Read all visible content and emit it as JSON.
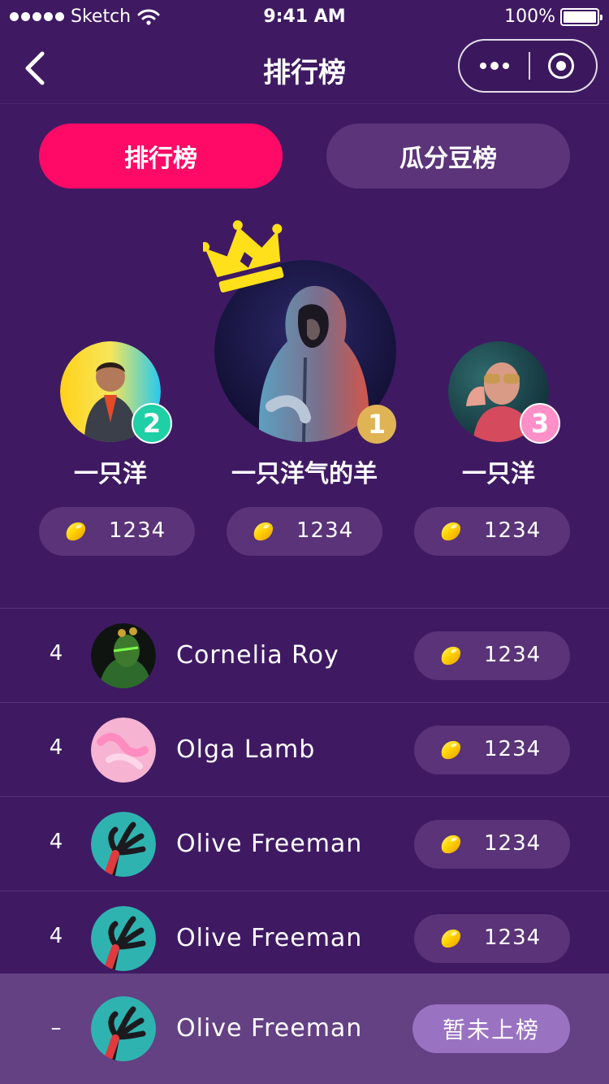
{
  "status_bar": {
    "carrier": "Sketch",
    "time": "9:41 AM",
    "battery": "100%",
    "battery_level": 1.0
  },
  "nav": {
    "title": "排行榜",
    "back_icon": "chevron-left-icon",
    "more_icon": "more-dots-icon",
    "close_icon": "record-circle-icon"
  },
  "tabs": [
    {
      "label": "排行榜",
      "active": true
    },
    {
      "label": "瓜分豆榜",
      "active": false
    }
  ],
  "podium": [
    {
      "rank": "1",
      "name": "一只洋气的羊",
      "score": "1234"
    },
    {
      "rank": "2",
      "name": "一只洋",
      "score": "1234"
    },
    {
      "rank": "3",
      "name": "一只洋",
      "score": "1234"
    }
  ],
  "list": [
    {
      "rank": "4",
      "name": "Cornelia Roy",
      "score": "1234"
    },
    {
      "rank": "4",
      "name": "Olga Lamb",
      "score": "1234"
    },
    {
      "rank": "4",
      "name": "Olive Freeman",
      "score": "1234"
    },
    {
      "rank": "4",
      "name": "Olive Freeman",
      "score": "1234"
    }
  ],
  "self": {
    "rank": "–",
    "name": "Olive Freeman",
    "status": "暂未上榜"
  },
  "colors": {
    "background": "#3f1a63",
    "tab_active": "#ff0a66",
    "tab_inactive": "#5b3479",
    "pill": "#5a3378",
    "self_row": "#634183",
    "not_ranked": "#9a72c2",
    "crown": "#ffe01b",
    "bean": "#ffcc00",
    "rank1_badge": "#e0b455",
    "rank2_badge": "#1fcfa6",
    "rank3_badge": "#ff8fc8"
  }
}
